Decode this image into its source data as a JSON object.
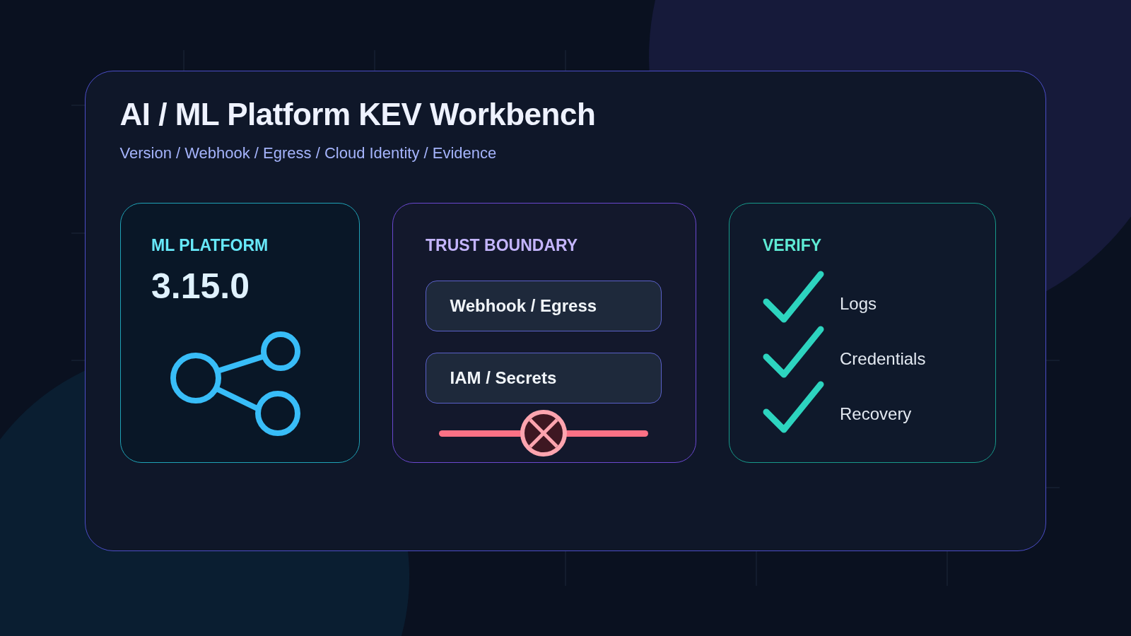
{
  "header": {
    "title": "AI / ML Platform KEV Workbench",
    "subtitle": "Version / Webhook / Egress / Cloud Identity / Evidence"
  },
  "cards": [
    {
      "kind": "platform",
      "label": "ML PLATFORM",
      "version": "3.15.0"
    },
    {
      "kind": "boundary",
      "label": "TRUST BOUNDARY",
      "items": [
        "Webhook / Egress",
        "IAM / Secrets"
      ]
    },
    {
      "kind": "verify",
      "label": "VERIFY",
      "checks": [
        {
          "label": "Logs",
          "checked": true
        },
        {
          "label": "Credentials",
          "checked": true
        },
        {
          "label": "Recovery",
          "checked": true
        }
      ]
    }
  ]
}
